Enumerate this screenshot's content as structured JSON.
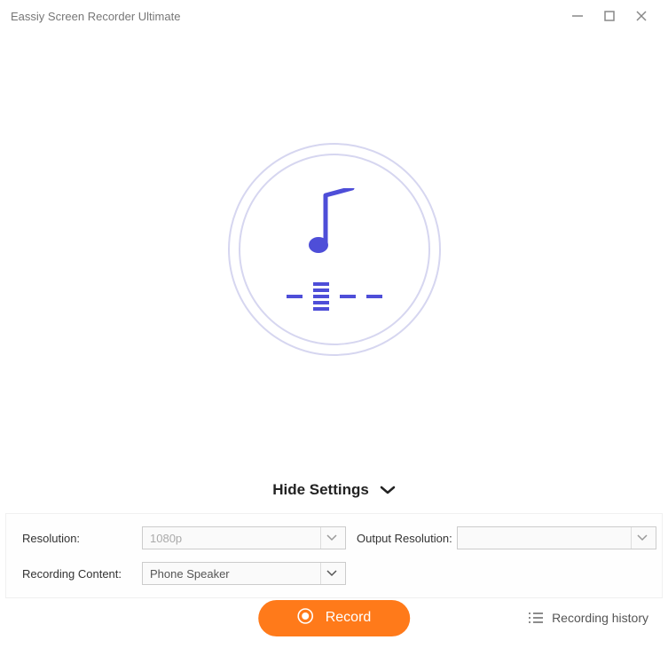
{
  "window": {
    "title": "Eassiy Screen Recorder Ultimate"
  },
  "centerIcon": "music-note-icon",
  "hideSettings": {
    "label": "Hide Settings"
  },
  "settings": {
    "resolution": {
      "label": "Resolution:",
      "value": "1080p"
    },
    "outputResolution": {
      "label": "Output Resolution:",
      "value": ""
    },
    "recordingContent": {
      "label": "Recording Content:",
      "value": "Phone Speaker"
    }
  },
  "footer": {
    "record": {
      "label": "Record"
    },
    "history": {
      "label": "Recording history"
    }
  }
}
